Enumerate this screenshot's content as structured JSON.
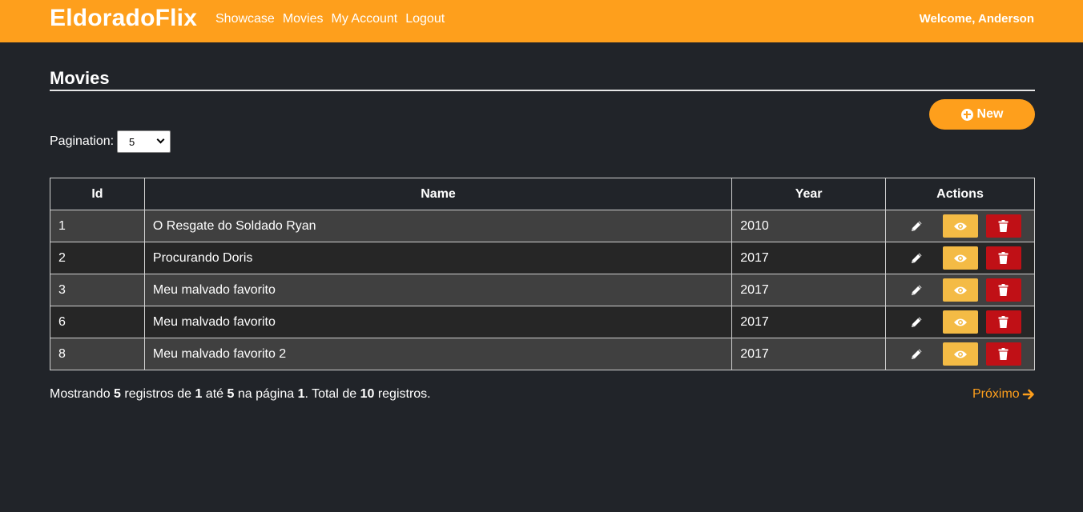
{
  "navbar": {
    "brand": "EldoradoFlix",
    "links": [
      "Showcase",
      "Movies",
      "My Account",
      "Logout"
    ],
    "welcome": "Welcome, Anderson",
    "color": "#fe9f1c"
  },
  "page": {
    "title": "Movies",
    "new_label": "New",
    "pagination_label": "Pagination:",
    "pagination_value": "5"
  },
  "table": {
    "headers": [
      "Id",
      "Name",
      "Year",
      "Actions"
    ],
    "rows": [
      {
        "id": "1",
        "name": "O Resgate do Soldado Ryan",
        "year": "2010"
      },
      {
        "id": "2",
        "name": "Procurando Doris",
        "year": "2017"
      },
      {
        "id": "3",
        "name": "Meu malvado favorito",
        "year": "2017"
      },
      {
        "id": "6",
        "name": "Meu malvado favorito",
        "year": "2017"
      },
      {
        "id": "8",
        "name": "Meu malvado favorito 2",
        "year": "2017"
      }
    ],
    "actions": [
      {
        "icon": "pencil-icon",
        "name": "edit"
      },
      {
        "icon": "eye-icon",
        "name": "view",
        "color": "#f4bb45"
      },
      {
        "icon": "trash-icon",
        "name": "delete",
        "color": "#c01016"
      }
    ]
  },
  "footer": {
    "t1": "Mostrando ",
    "shown": "5",
    "t2": " registros de ",
    "from": "1",
    "t3": " até ",
    "to": "5",
    "t4": " na página ",
    "page": "1",
    "t5": ". Total de ",
    "total": "10",
    "t6": " registros.",
    "next_label": "Próximo"
  }
}
